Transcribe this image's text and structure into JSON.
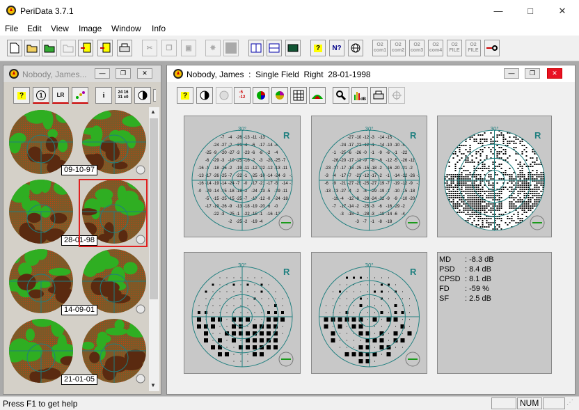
{
  "app": {
    "title": "PeriData 3.7.1"
  },
  "menu": [
    "File",
    "Edit",
    "View",
    "Image",
    "Window",
    "Info"
  ],
  "toolbar": {
    "com_labels": [
      "com1",
      "com2",
      "com3",
      "com4",
      "FILE",
      "FILE"
    ]
  },
  "left_window": {
    "title": "Nobody, James...",
    "toolbar_labels": [
      "?",
      "1",
      "LR",
      "i",
      "24 16\n31 c0"
    ],
    "dates": [
      "09-10-97",
      "28-01-98",
      "14-09-01",
      "21-01-05"
    ]
  },
  "right_window": {
    "title": "Nobody, James  :  Single Field  Right  28-01-1998",
    "toolbar_labels": [
      "?",
      "-5\n-12",
      "dB"
    ],
    "panels": {
      "eccentricity_label": "30°",
      "eye_label": "R"
    },
    "stats": [
      {
        "label": "MD",
        "value": ": -8.3 dB"
      },
      {
        "label": "PSD",
        "value": ": 8.4 dB"
      },
      {
        "label": "CPSD",
        "value": ": 8.1 dB"
      },
      {
        "label": "FD",
        "value": ": -59 %"
      },
      {
        "label": "SF",
        "value": ": 2.5 dB"
      }
    ]
  },
  "status": {
    "help": "Press F1 to get help",
    "num": "NUM"
  }
}
